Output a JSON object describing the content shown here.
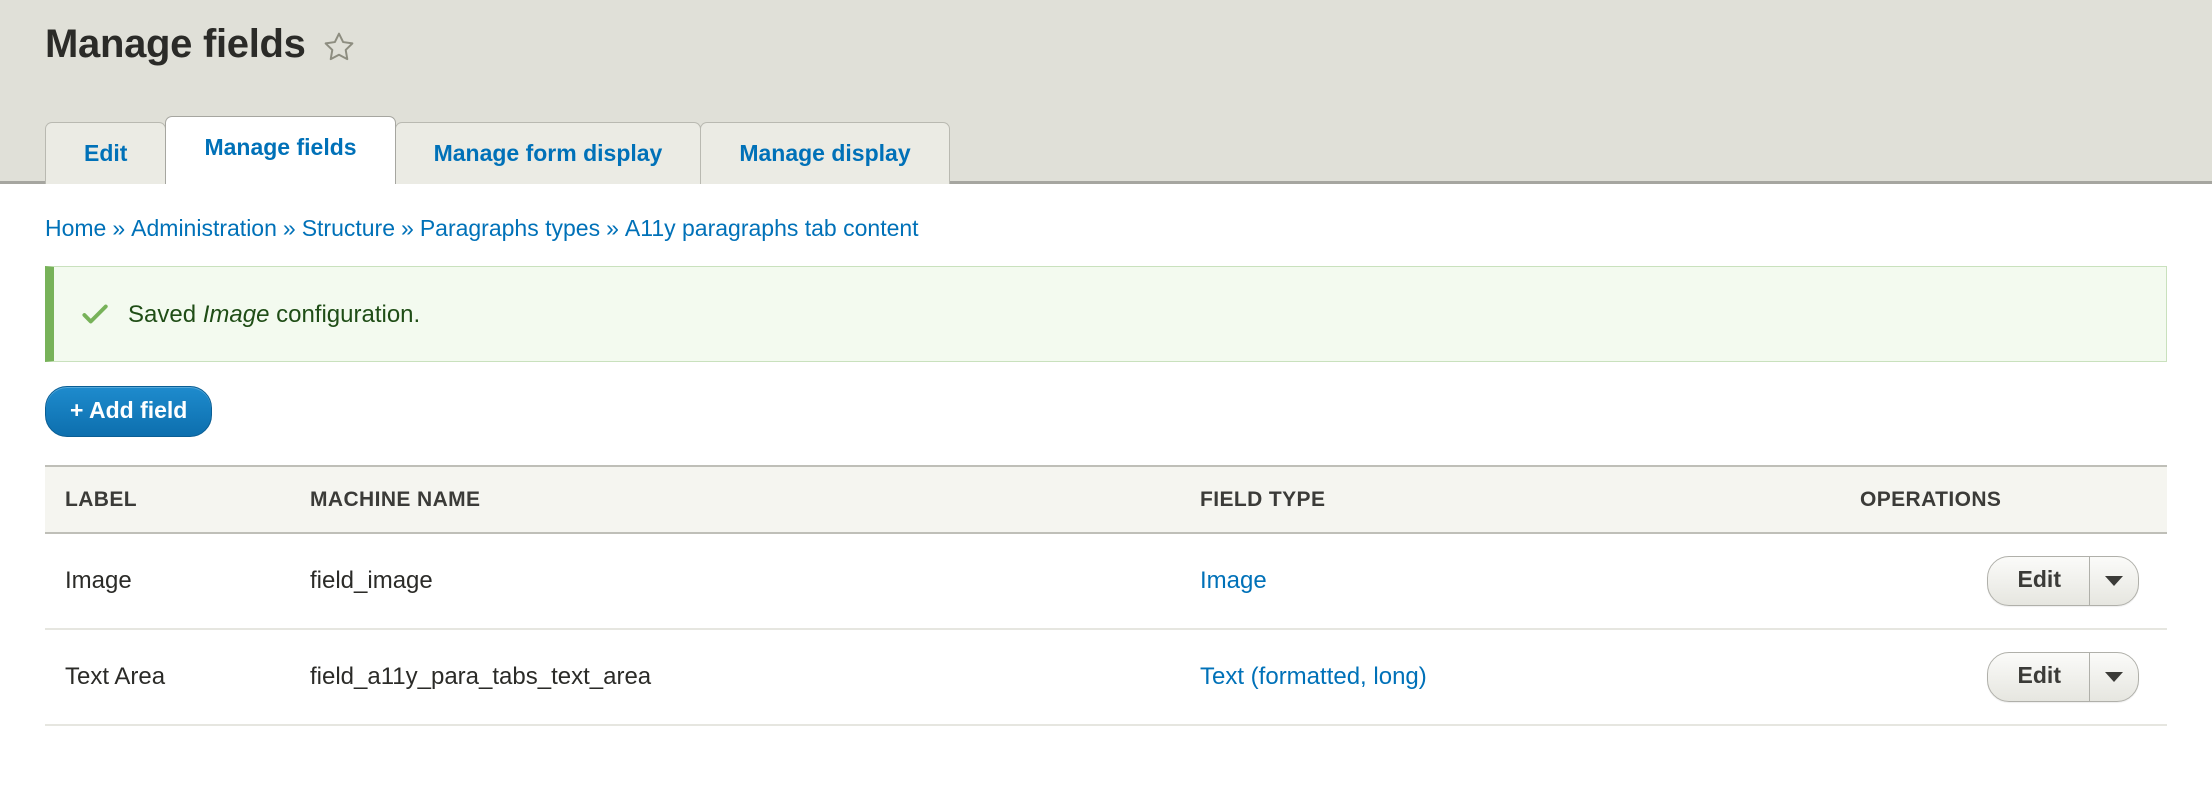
{
  "header": {
    "title": "Manage fields",
    "shortcut_star_icon": "star-outline-icon"
  },
  "tabs": [
    {
      "label": "Edit",
      "active": false
    },
    {
      "label": "Manage fields",
      "active": true
    },
    {
      "label": "Manage form display",
      "active": false
    },
    {
      "label": "Manage display",
      "active": false
    }
  ],
  "breadcrumb": {
    "separator": "»",
    "items": [
      {
        "label": "Home"
      },
      {
        "label": "Administration"
      },
      {
        "label": "Structure"
      },
      {
        "label": "Paragraphs types"
      },
      {
        "label": "A11y paragraphs tab content"
      }
    ]
  },
  "status_message": {
    "icon": "check-icon",
    "prefix": "Saved ",
    "emphasis": "Image",
    "suffix": " configuration.",
    "accent_color": "#77b259",
    "background_color": "#f3faef"
  },
  "actions": {
    "add_field_label": "+ Add field",
    "add_field_color": "#0d6fae"
  },
  "table": {
    "columns": [
      "LABEL",
      "MACHINE NAME",
      "FIELD TYPE",
      "OPERATIONS"
    ],
    "rows": [
      {
        "label": "Image",
        "machine_name": "field_image",
        "field_type": "Image",
        "operation_label": "Edit",
        "operation_toggle_icon": "chevron-down-icon"
      },
      {
        "label": "Text Area",
        "machine_name": "field_a11y_para_tabs_text_area",
        "field_type": "Text (formatted, long)",
        "operation_label": "Edit",
        "operation_toggle_icon": "chevron-down-icon"
      }
    ]
  },
  "colors": {
    "link": "#0071b8",
    "header_bg": "#e0e0d8",
    "table_header_bg": "#f5f5f0"
  }
}
